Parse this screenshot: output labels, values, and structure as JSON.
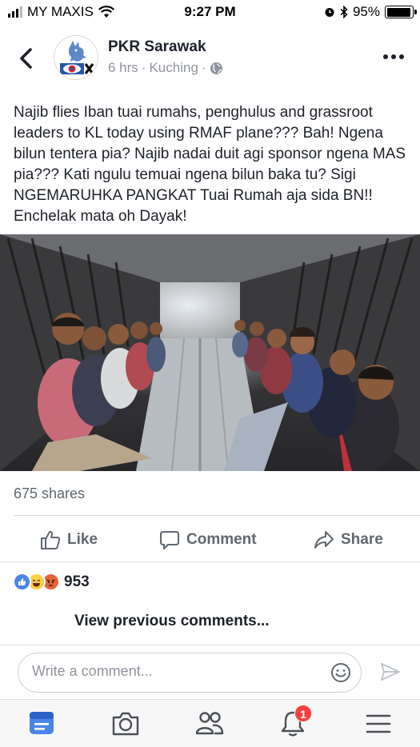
{
  "status_bar": {
    "carrier": "MY MAXIS",
    "time": "9:27 PM",
    "battery": "95%",
    "battery_level": 0.95
  },
  "post": {
    "page_name": "PKR Sarawak",
    "time": "6 hrs",
    "location": "Kuching",
    "separator": "·",
    "text": "Najib flies Iban tuai rumahs, penghulus and grassroot leaders to KL today using RMAF plane??? Bah! Ngena bilun tentera pia? Najib nadai duit agi sponsor ngena MAS pia??? Kati ngulu temuai ngena bilun baka tu? Sigi NGEMARUHKA PANGKAT Tuai Rumah aja sida BN!! Enchelak mata oh Dayak!",
    "photo_icon": "photo-airplane-cabin"
  },
  "stats": {
    "shares": "675 shares",
    "reaction_count": "953",
    "reaction_icons": [
      "like-icon",
      "haha-icon",
      "angry-icon"
    ]
  },
  "actions": {
    "like": "Like",
    "comment": "Comment",
    "share": "Share"
  },
  "comments": {
    "view_previous": "View previous comments...",
    "placeholder": "Write a comment..."
  },
  "tabbar": {
    "items": [
      "news-feed-icon",
      "camera-icon",
      "friends-icon",
      "notifications-icon",
      "menu-icon"
    ],
    "notification_badge": "1"
  },
  "colors": {
    "accent": "#4267b2",
    "badge": "#fa3e3e",
    "text": "#1d2129",
    "muted": "#606770"
  }
}
